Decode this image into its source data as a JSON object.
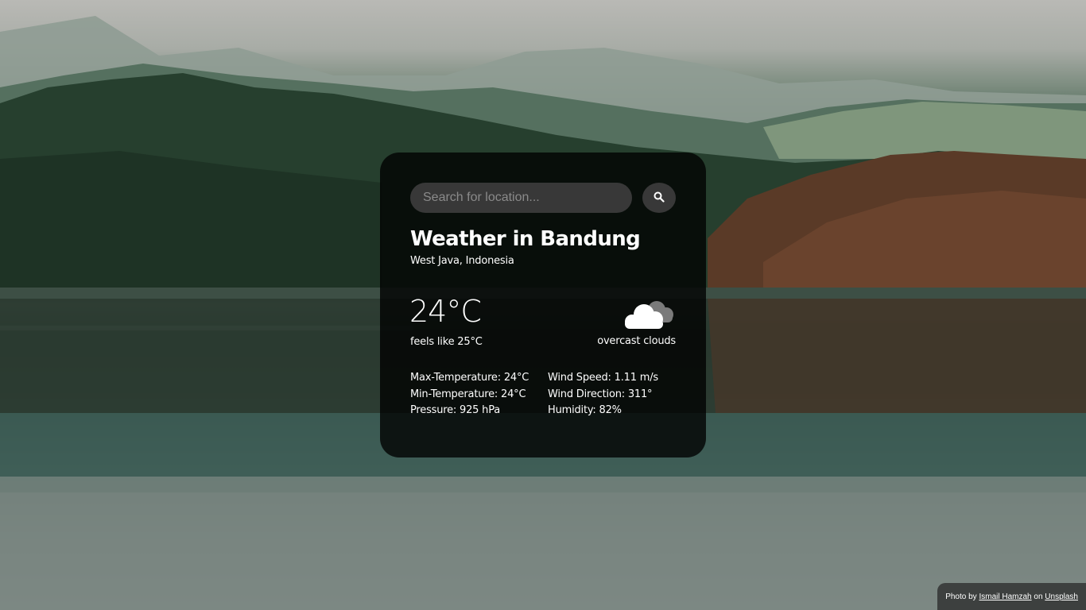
{
  "search": {
    "placeholder": "Search for location...",
    "value": ""
  },
  "weather": {
    "title": "Weather in Bandung",
    "location": "West Java, Indonesia",
    "temperature": "24°C",
    "feels_like": "feels like 25°C",
    "description": "overcast clouds",
    "icon": "overcast-cloud-icon"
  },
  "details": {
    "left": [
      "Max-Temperature: 24°C",
      "Min-Temperature: 24°C",
      "Pressure: 925 hPa"
    ],
    "right": [
      "Wind Speed: 1.11 m/s",
      "Wind Direction: 311°",
      "Humidity: 82%"
    ]
  },
  "credit": {
    "prefix": "Photo by",
    "author": "Ismail Hamzah",
    "middle": "on",
    "site": "Unsplash"
  },
  "colors": {
    "card_background": "#000000c7",
    "input_background": "#383838",
    "text": "#ffffff"
  }
}
